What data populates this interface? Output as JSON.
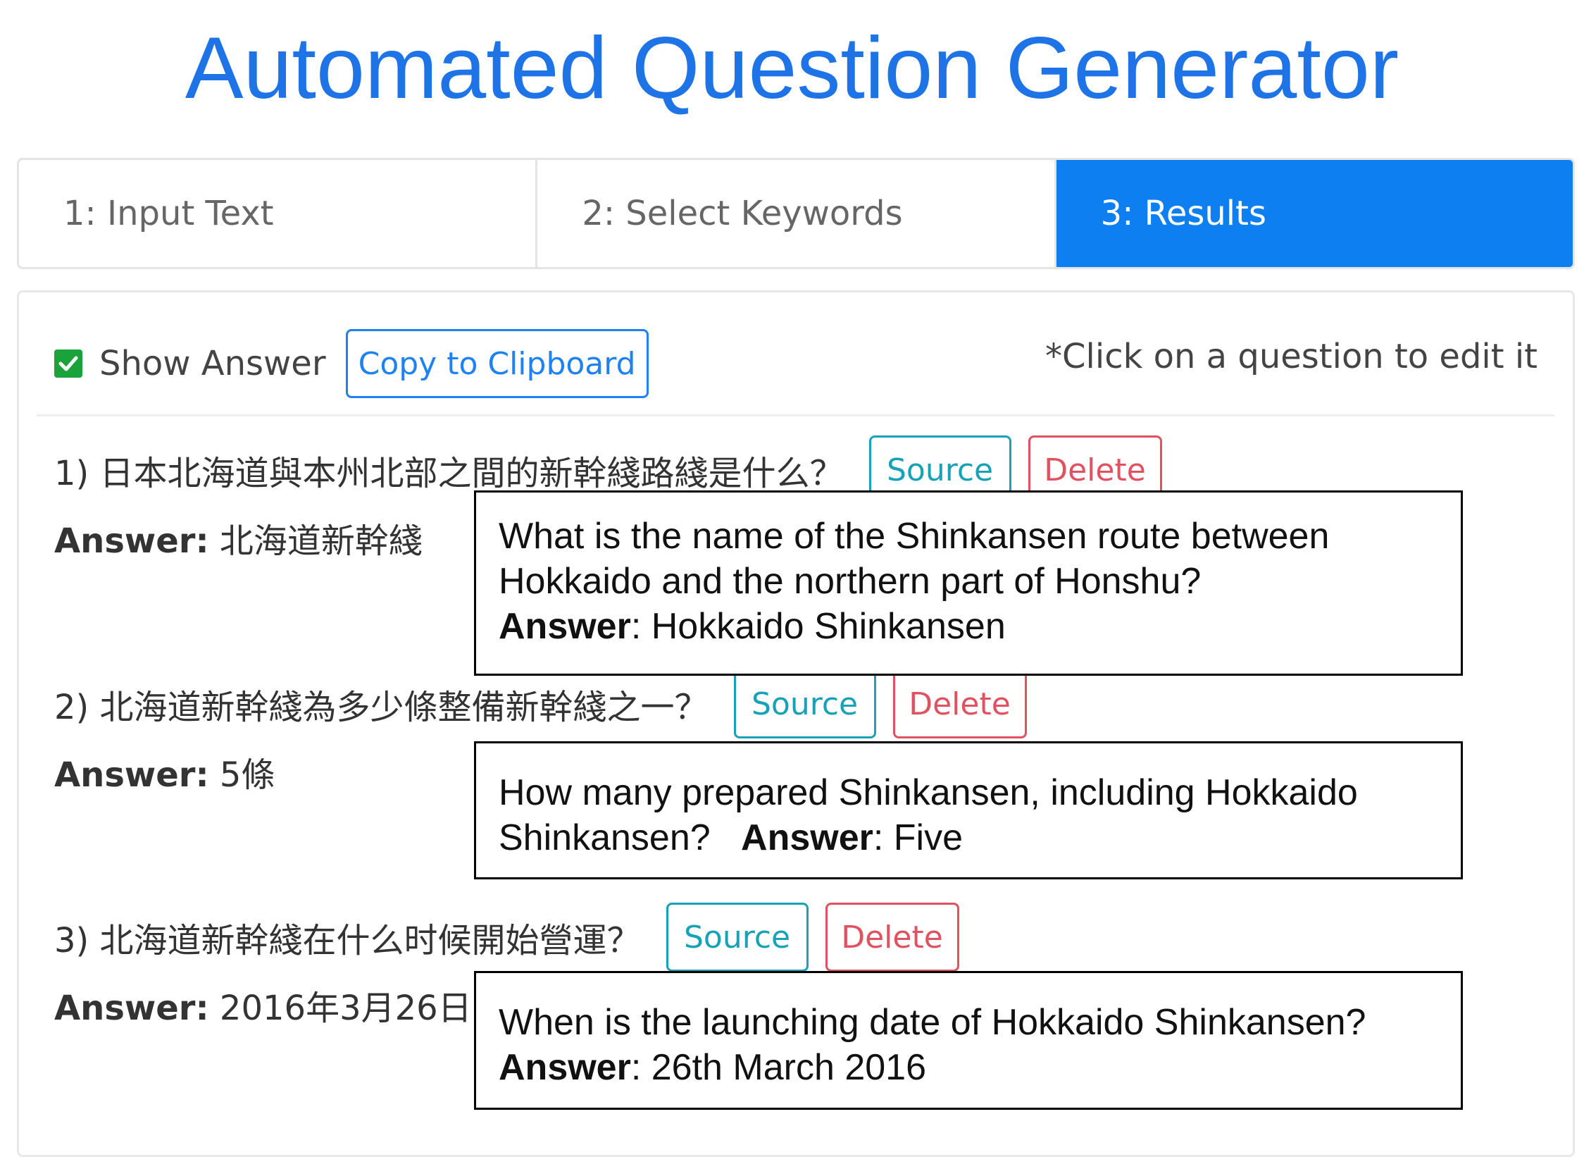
{
  "title": "Automated Question Generator",
  "tabs": [
    {
      "label": "1: Input Text",
      "active": false
    },
    {
      "label": "2: Select Keywords",
      "active": false
    },
    {
      "label": "3: Results",
      "active": true
    }
  ],
  "toolbar": {
    "show_answer_label": "Show Answer",
    "show_answer_checked": true,
    "copy_label": "Copy to Clipboard",
    "hint": "*Click on a question to edit it"
  },
  "buttons": {
    "source_label": "Source",
    "delete_label": "Delete"
  },
  "answer_label": "Answer:",
  "translation_answer_label": "Answer",
  "questions": [
    {
      "text": "1) 日本北海道與本州北部之間的新幹綫路綫是什么？",
      "answer": "北海道新幹綫"
    },
    {
      "text": "2) 北海道新幹綫為多少條整備新幹綫之一？",
      "answer": "5條"
    },
    {
      "text": "3) 北海道新幹綫在什么时候開始營運？",
      "answer": "2016年3月26日"
    }
  ],
  "translations": [
    {
      "line1": "What is the name of the Shinkansen route between",
      "line2": "Hokkaido and the northern part of Honshu?",
      "answer": "Hokkaido Shinkansen"
    },
    {
      "line1": "How many prepared Shinkansen, including  Hokkaido",
      "line2": "Shinkansen?",
      "answer": "Five"
    },
    {
      "line1": "When is the launching date of Hokkaido Shinkansen?",
      "answer": "26th March 2016"
    }
  ],
  "colors": {
    "accent": "#0d7ff0",
    "source": "#17a2b8",
    "delete": "#e05260",
    "check": "#1aa33a"
  }
}
